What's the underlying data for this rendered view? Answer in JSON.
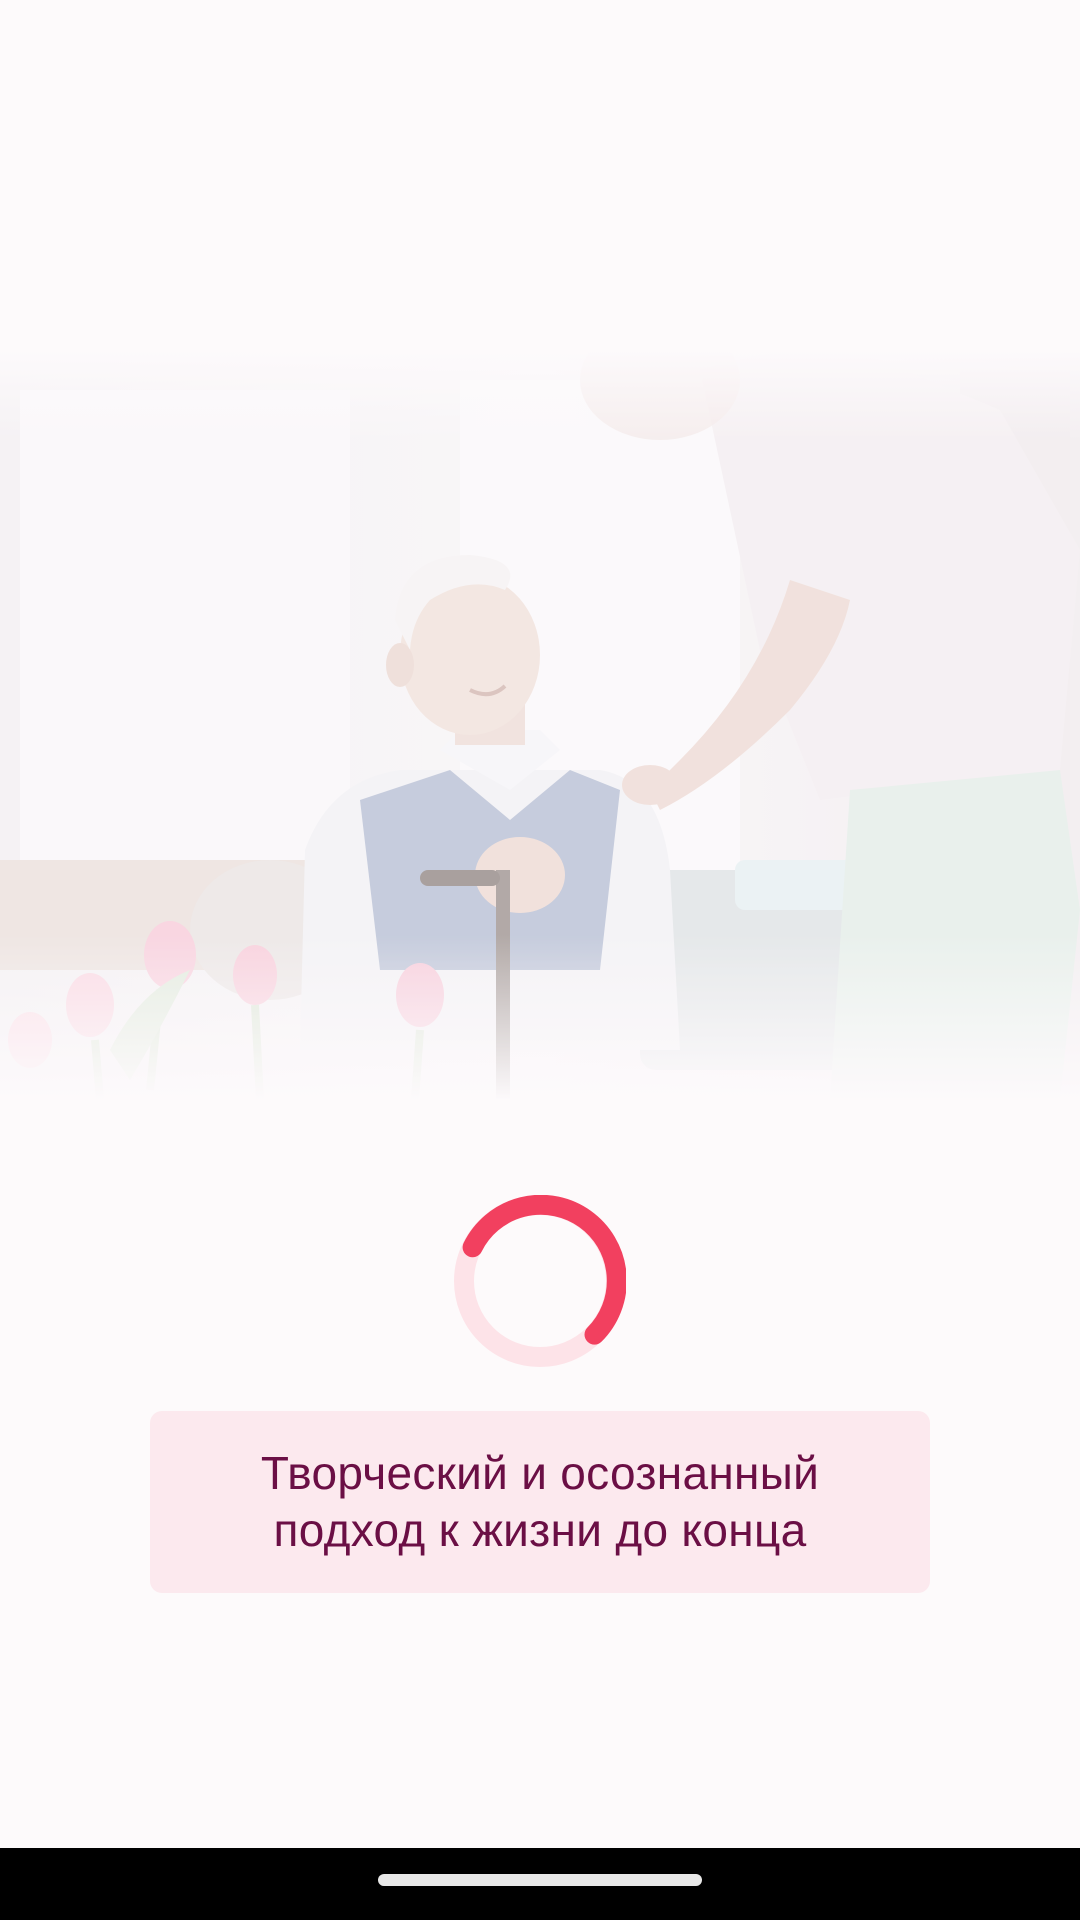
{
  "splash": {
    "hero_image": "elderly-man-with-cane-and-caregiver-photo",
    "loading": {
      "icon": "loading-spinner-icon",
      "accent_color": "#f2405f",
      "track_color": "#fde3e8"
    },
    "tagline": "Творческий и осознанный подход к жизни до конца"
  },
  "system": {
    "nav_bar_color": "#000000",
    "home_indicator": "home-indicator"
  }
}
